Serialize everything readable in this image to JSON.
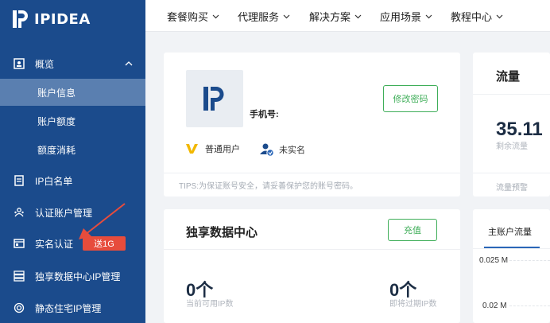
{
  "brand": {
    "name": "IPIDEA"
  },
  "sidebar": {
    "overview": {
      "label": "概览"
    },
    "sub_items": [
      {
        "label": "账户信息"
      },
      {
        "label": "账户额度"
      },
      {
        "label": "额度消耗"
      }
    ],
    "items": [
      {
        "label": "IP白名单"
      },
      {
        "label": "认证账户管理"
      },
      {
        "label": "实名认证"
      },
      {
        "label": "独享数据中心IP管理"
      },
      {
        "label": "静态住宅IP管理"
      }
    ],
    "badge": "送1G"
  },
  "topnav": {
    "menus": [
      {
        "label": "套餐购买"
      },
      {
        "label": "代理服务"
      },
      {
        "label": "解决方案"
      },
      {
        "label": "应用场景"
      },
      {
        "label": "教程中心"
      }
    ]
  },
  "account_card": {
    "phone_label": "手机号:",
    "change_password": "修改密码",
    "user_type": "普通用户",
    "verify_status": "未实名",
    "tips": "TIPS:为保证账号安全，请妥善保护您的账号密码。"
  },
  "traffic_card": {
    "title": "流量",
    "value": "35.11",
    "remaining_label": "剩余流量",
    "warning_label": "流量预警"
  },
  "datacenter_card": {
    "title": "独享数据中心",
    "recharge": "充值",
    "current_count": "0个",
    "current_label": "当前可用IP数",
    "expiring_count": "0个",
    "expiring_label": "即将过期IP数"
  },
  "chart_card": {
    "tab": "主账户流量",
    "y_ticks": [
      "0.025 M",
      "0.02 M"
    ]
  },
  "colors": {
    "sidebar": "#1b4b8c",
    "active": "#5a7fb0",
    "accent_green": "#3fae59",
    "badge_red": "#e74c3c"
  }
}
